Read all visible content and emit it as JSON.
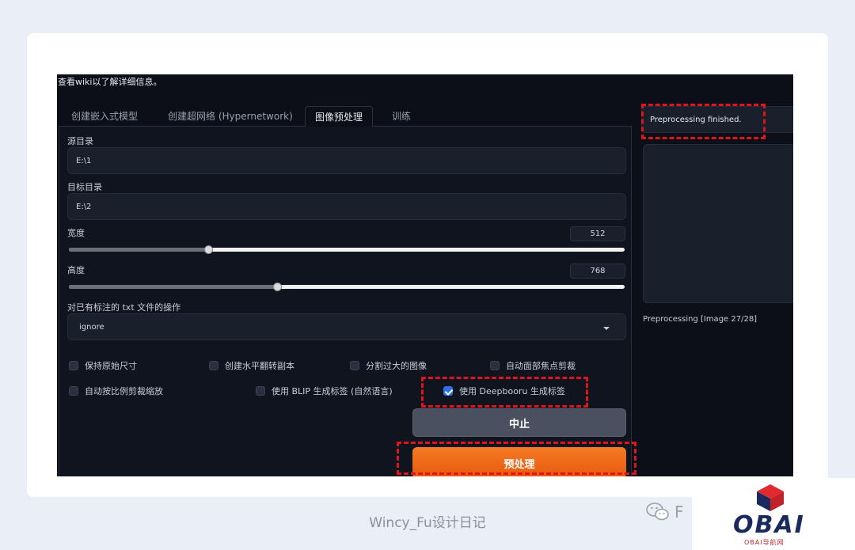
{
  "header": {
    "wiki_text": "查看wiki以了解详细信息。"
  },
  "tabs": [
    {
      "label": "创建嵌入式模型"
    },
    {
      "label": "创建超网络 (Hypernetwork)"
    },
    {
      "label": "图像预处理"
    },
    {
      "label": "训练"
    }
  ],
  "form": {
    "source_dir_label": "源目录",
    "source_dir_value": "E:\\1",
    "target_dir_label": "目标目录",
    "target_dir_value": "E:\\2",
    "width_label": "宽度",
    "width_value": "512",
    "width_fraction": 0.25,
    "height_label": "高度",
    "height_value": "768",
    "height_fraction": 0.375,
    "caption_action_label": "对已有标注的 txt 文件的操作",
    "caption_action_value": "ignore"
  },
  "checkboxes": [
    {
      "label": "保持原始尺寸",
      "checked": false
    },
    {
      "label": "创建水平翻转副本",
      "checked": false
    },
    {
      "label": "分割过大的图像",
      "checked": false
    },
    {
      "label": "自动面部焦点剪裁",
      "checked": false
    },
    {
      "label": "自动按比例剪裁缩放",
      "checked": false
    },
    {
      "label": "使用 BLIP 生成标签 (自然语言)",
      "checked": false
    },
    {
      "label": "使用 Deepbooru 生成标签",
      "checked": true
    }
  ],
  "buttons": {
    "interrupt": "中止",
    "preprocess": "预处理"
  },
  "output": {
    "status": "Preprocessing finished.",
    "progress": "Preprocessing [Image 27/28]"
  },
  "footer": {
    "caption": "Wincy_Fu设计日记",
    "wechat_text": "F",
    "logo_text": "OBAI",
    "logo_sub": "OBAI导航网"
  },
  "colors": {
    "accent_orange": "#e8580c",
    "highlight_red": "#e0141b",
    "checkbox_blue": "#2f6fe4"
  }
}
